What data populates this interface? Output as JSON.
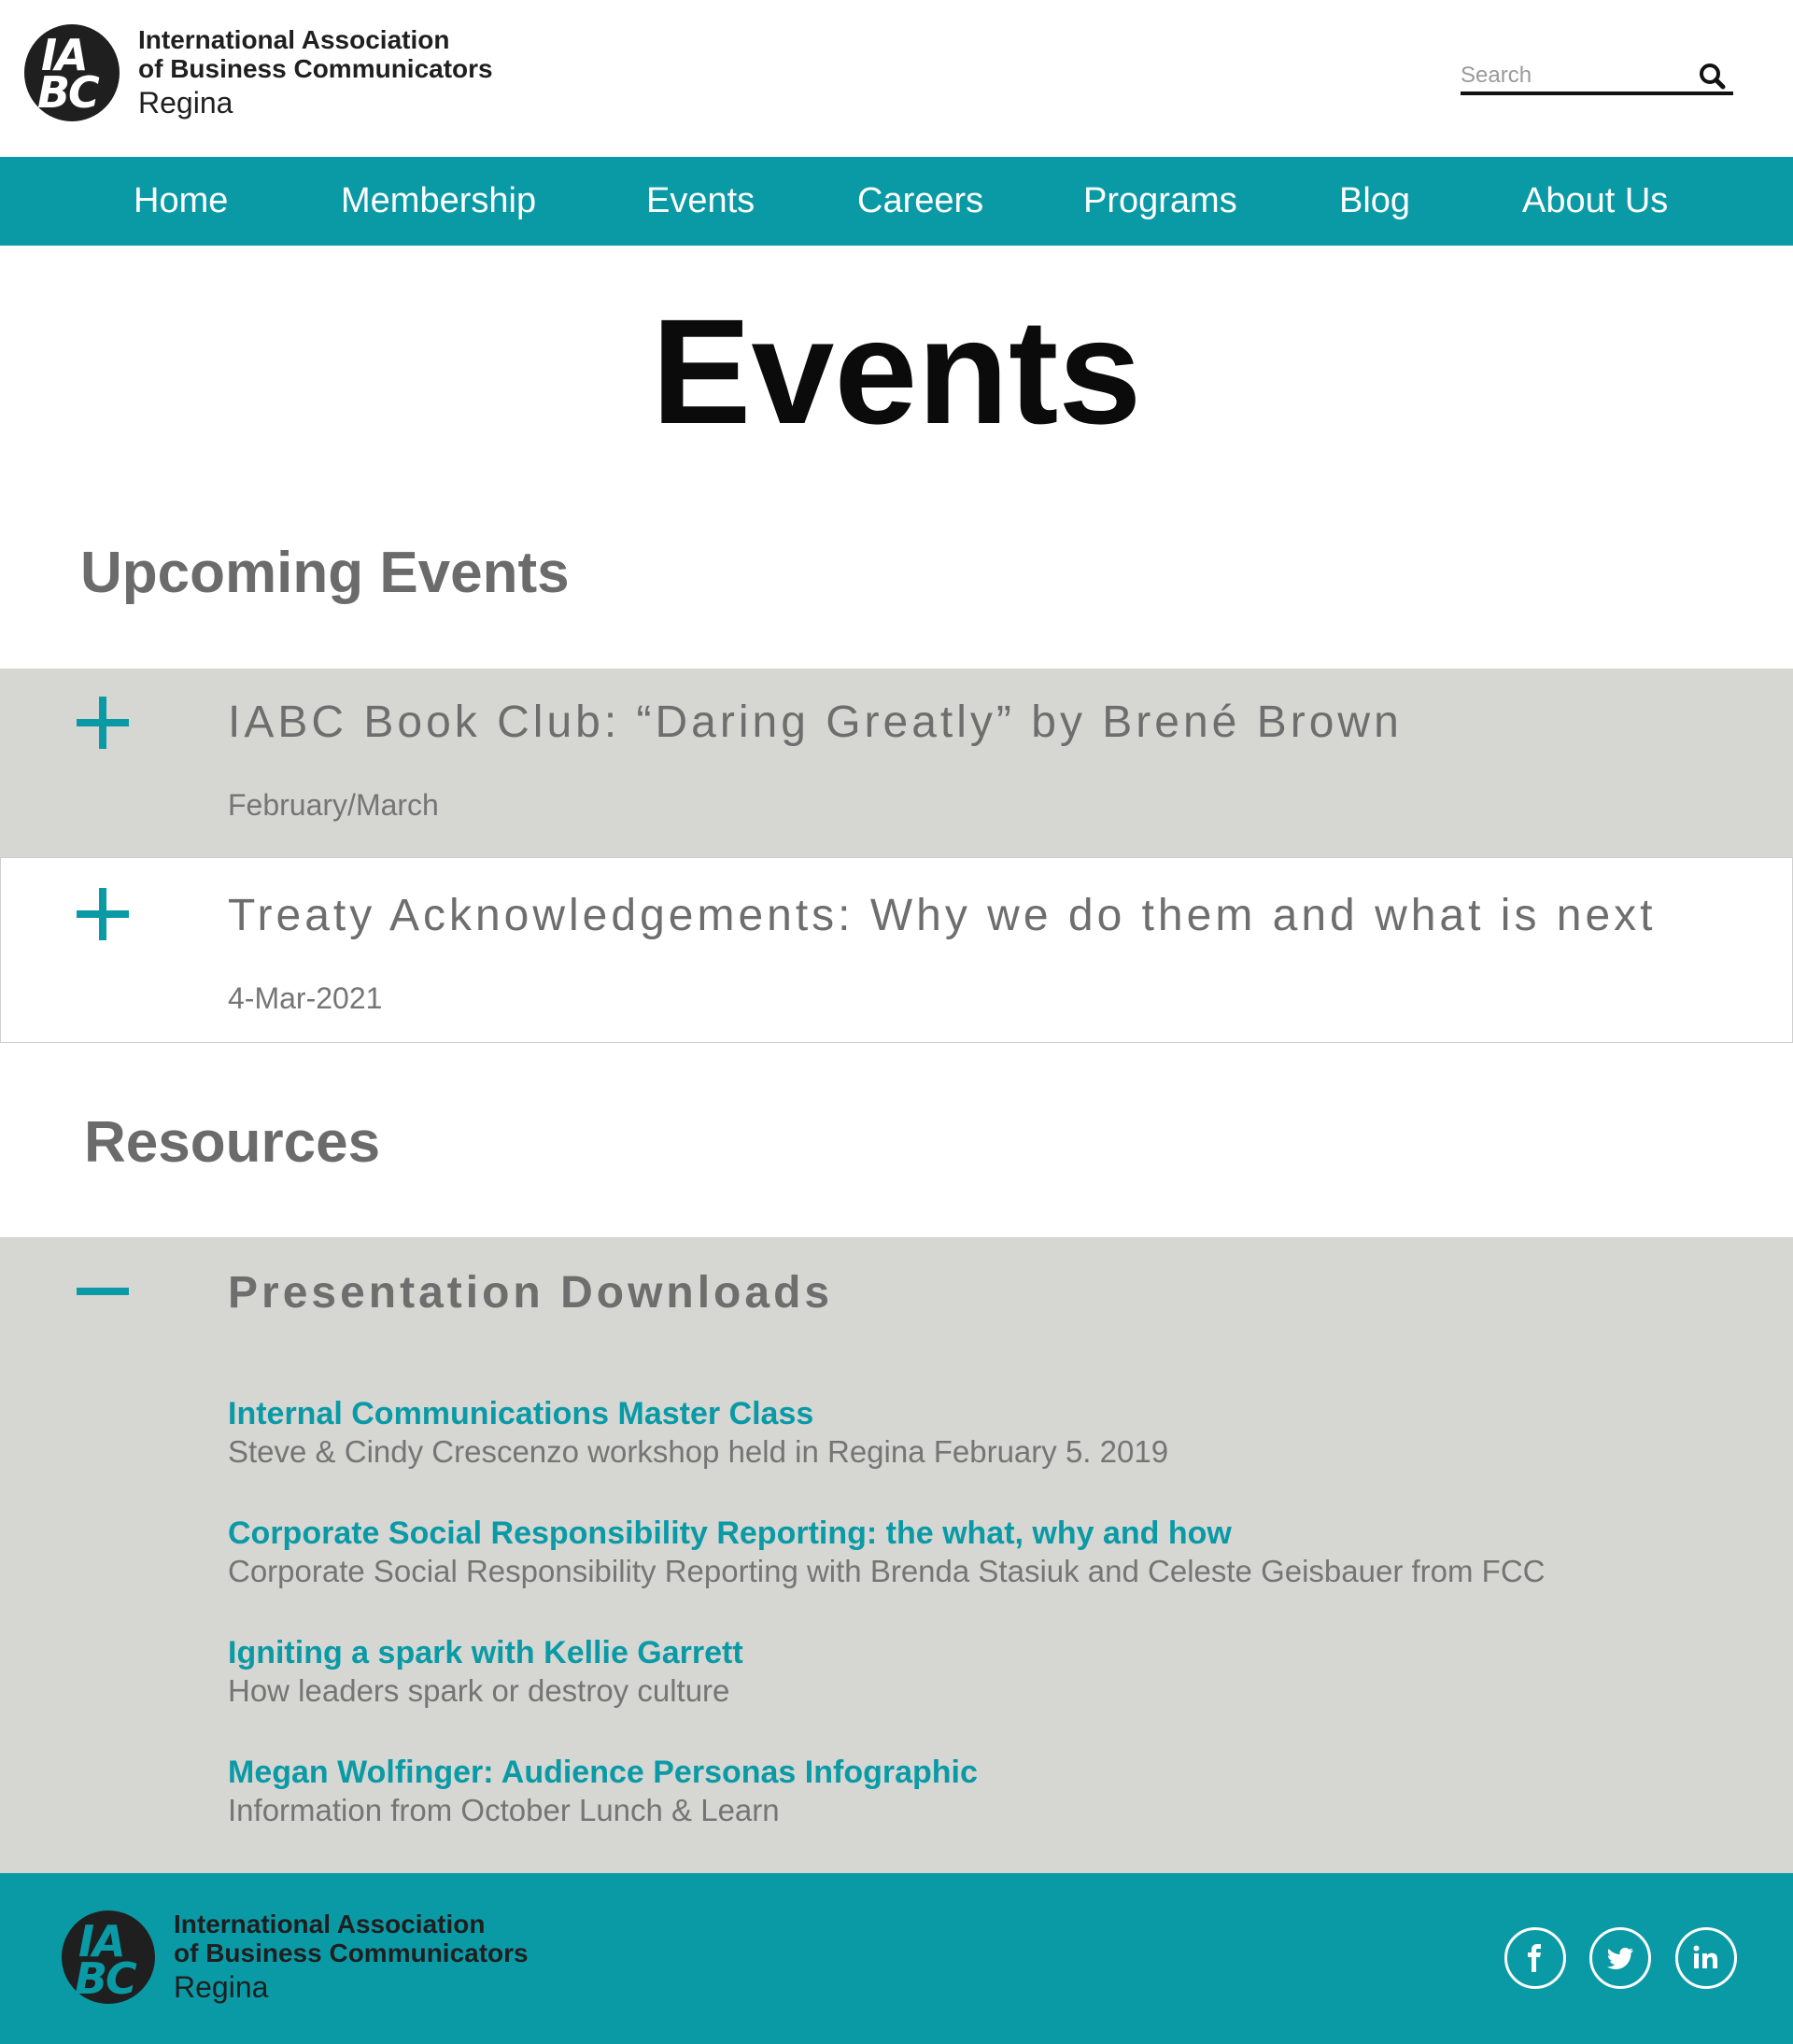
{
  "header": {
    "logo": {
      "mark_line1": "IA",
      "mark_line2": "BC",
      "line1": "International Association",
      "line2": "of Business Communicators",
      "line3": "Regina"
    },
    "search": {
      "placeholder": "Search",
      "value": "",
      "icon": "search-icon"
    }
  },
  "nav": {
    "items": [
      {
        "label": "Home"
      },
      {
        "label": "Membership"
      },
      {
        "label": "Events"
      },
      {
        "label": "Careers"
      },
      {
        "label": "Programs"
      },
      {
        "label": "Blog"
      },
      {
        "label": "About Us"
      }
    ]
  },
  "page": {
    "title": "Events"
  },
  "upcoming": {
    "heading": "Upcoming Events",
    "events": [
      {
        "title": "IABC Book Club: “Daring Greatly” by Brené Brown",
        "date": "February/March",
        "state": "collapsed",
        "icon": "plus-icon"
      },
      {
        "title": "Treaty Acknowledgements: Why we do them and what is next",
        "date": "4-Mar-2021",
        "state": "collapsed",
        "icon": "plus-icon"
      }
    ]
  },
  "resources": {
    "heading": "Resources",
    "panel": {
      "title": "Presentation Downloads",
      "state": "expanded",
      "icon": "minus-icon",
      "items": [
        {
          "link": "Internal Communications Master Class",
          "desc": "Steve & Cindy Crescenzo workshop held in Regina February 5. 2019"
        },
        {
          "link": "Corporate Social Responsibility Reporting: the what, why and how",
          "desc": "Corporate Social Responsibility Reporting with Brenda Stasiuk and Celeste Geisbauer from FCC"
        },
        {
          "link": "Igniting a spark with Kellie Garrett",
          "desc": "How leaders spark or destroy culture"
        },
        {
          "link": "Megan Wolfinger: Audience Personas Infographic",
          "desc": "Information from October Lunch & Learn"
        }
      ]
    }
  },
  "footer": {
    "logo": {
      "mark_line1": "IA",
      "mark_line2": "BC",
      "line1": "International Association",
      "line2": "of Business Communicators",
      "line3": "Regina"
    },
    "social": [
      {
        "icon": "facebook-icon"
      },
      {
        "icon": "twitter-icon"
      },
      {
        "icon": "linkedin-icon"
      }
    ]
  },
  "colors": {
    "brand_teal": "#0a9aa6",
    "accordion_grey": "#d6d6d3",
    "heading_grey": "#6b6b6b",
    "logo_dark": "#1f1f1f"
  }
}
